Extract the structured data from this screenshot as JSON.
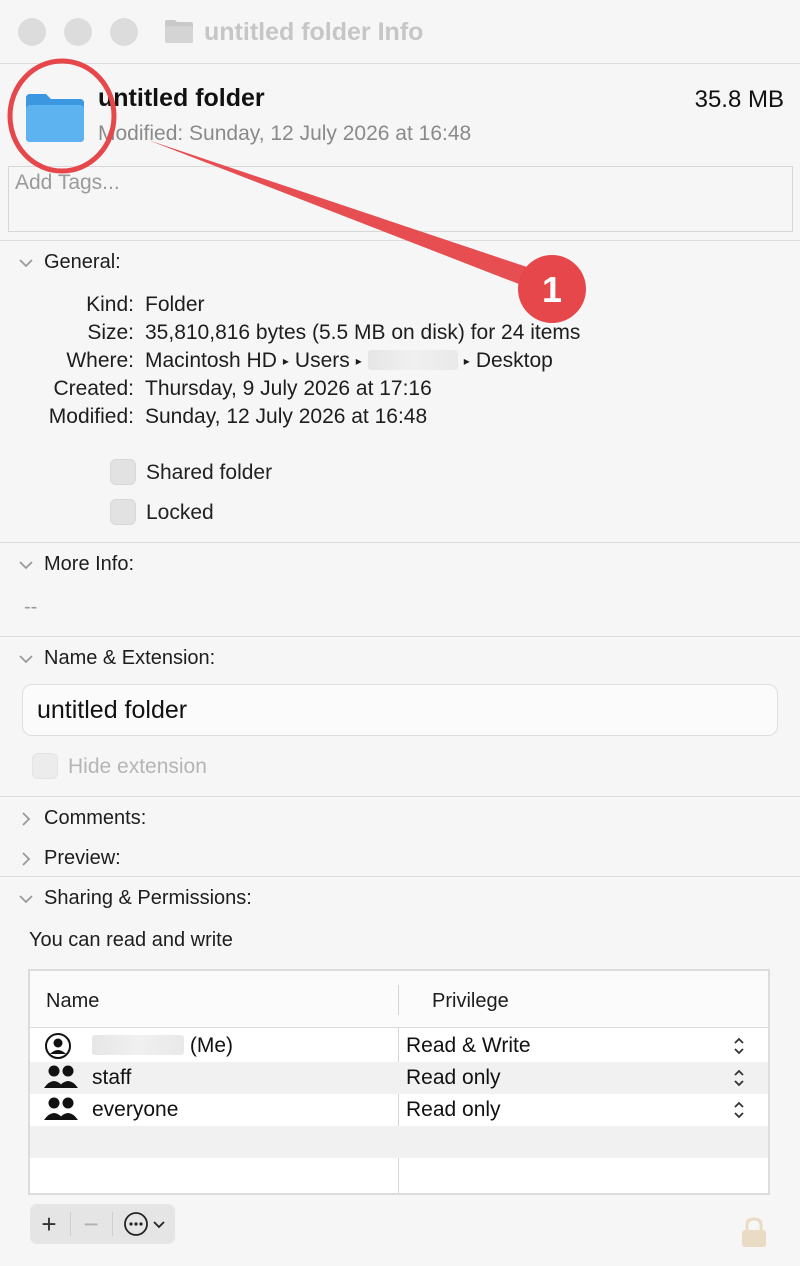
{
  "window": {
    "title": "untitled folder Info"
  },
  "header": {
    "name": "untitled folder",
    "size": "35.8 MB",
    "modified": "Modified: Sunday, 12 July 2026 at 16:48",
    "tags_placeholder": "Add Tags..."
  },
  "general": {
    "heading": "General:",
    "kind_label": "Kind:",
    "kind_value": "Folder",
    "size_label": "Size:",
    "size_value": "35,810,816 bytes (5.5 MB on disk) for 24 items",
    "where_label": "Where:",
    "where_path": [
      "Macintosh HD",
      "Users",
      "Desktop"
    ],
    "created_label": "Created:",
    "created_value": "Thursday, 9 July 2026 at 17:16",
    "modified_label": "Modified:",
    "modified_value": "Sunday, 12 July 2026 at 16:48",
    "shared_folder_label": "Shared folder",
    "locked_label": "Locked"
  },
  "more_info": {
    "heading": "More Info:",
    "value": "--"
  },
  "name_extension": {
    "heading": "Name & Extension:",
    "value": "untitled folder",
    "hide_extension_label": "Hide extension"
  },
  "comments": {
    "heading": "Comments:"
  },
  "preview": {
    "heading": "Preview:"
  },
  "sharing": {
    "heading": "Sharing & Permissions:",
    "status": "You can read and write",
    "col_name": "Name",
    "col_privilege": "Privilege",
    "rows": [
      {
        "name": "(Me)",
        "privilege": "Read & Write",
        "icon": "person-icon"
      },
      {
        "name": "staff",
        "privilege": "Read only",
        "icon": "group-icon"
      },
      {
        "name": "everyone",
        "privilege": "Read only",
        "icon": "group-icon"
      }
    ],
    "buttons": {
      "add": "+",
      "remove": "−"
    }
  },
  "annotation": {
    "number": "1",
    "color": "#e5474a"
  }
}
